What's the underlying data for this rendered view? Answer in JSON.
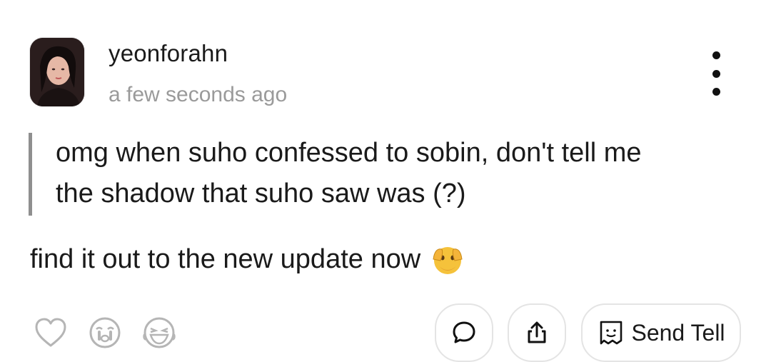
{
  "post": {
    "username": "yeonforahn",
    "timestamp": "a few seconds ago",
    "quote_lines": [
      "omg when suho confessed to sobin, don't tell me",
      "the shadow that suho saw was (?)"
    ],
    "body": "find it out to the new update now"
  },
  "icons": {
    "avatar": "profile-photo",
    "more": "vertical-ellipsis-icon",
    "body_emoji": "face-with-open-eyes-and-hand-over-mouth-emoji",
    "reactions": [
      "heart-icon",
      "crying-face-icon",
      "laughing-face-icon"
    ],
    "comment": "speech-bubble-icon",
    "share": "share-upload-icon",
    "send_tell": "envelope-note-icon"
  },
  "actions": {
    "send_tell_label": "Send Tell"
  },
  "colors": {
    "text": "#1a1a1a",
    "muted": "#9a9a9a",
    "quote_bar": "#8f8f8f",
    "border": "#e4e4e4",
    "emoji_yellow": "#f5c23b"
  }
}
